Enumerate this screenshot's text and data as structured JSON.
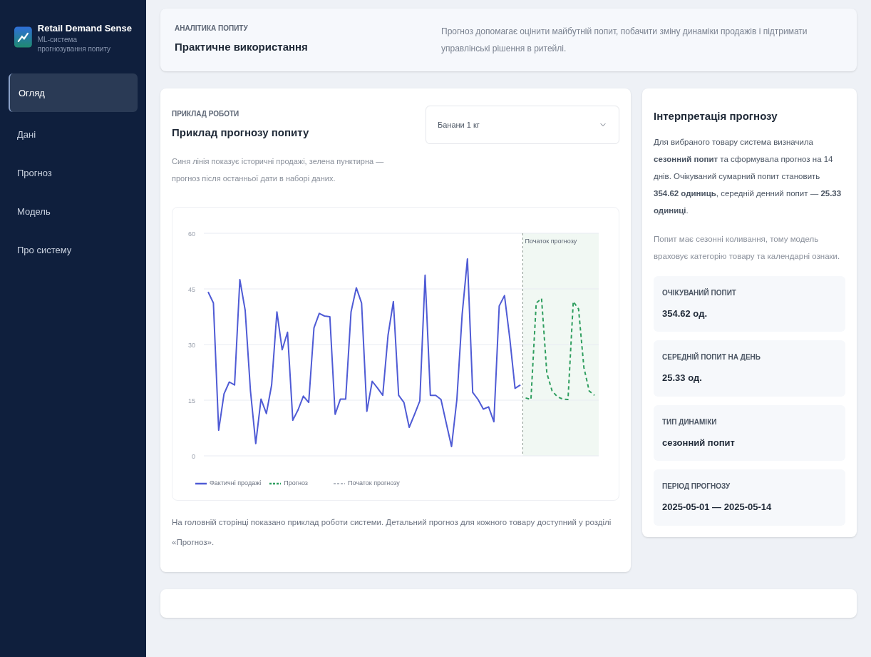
{
  "sidebar": {
    "brand": {
      "title": "Retail Demand Sense",
      "subtitle": "ML-система прогнозування попиту"
    },
    "items": [
      {
        "label": "Огляд",
        "selected": true
      },
      {
        "label": "Дані",
        "selected": false
      },
      {
        "label": "Прогноз",
        "selected": false
      },
      {
        "label": "Модель",
        "selected": false
      },
      {
        "label": "Про систему",
        "selected": false
      }
    ]
  },
  "header": {
    "eyebrow": "АНАЛІТИКА ПОПИТУ",
    "title": "Практичне використання",
    "description": "Прогноз допомагає оцінити майбутній попит, побачити зміну динаміки продажів і підтримати управлінські рішення в ритейлі."
  },
  "example": {
    "eyebrow": "ПРИКЛАД РОБОТИ",
    "title": "Приклад прогнозу попиту",
    "product_select": {
      "value": "Банани 1 кг"
    },
    "description": "Синя лінія показує історичні продажі, зелена пунктирна — прогноз після останньої дати в наборі даних.",
    "chart_data": {
      "type": "line",
      "ylim": [
        0,
        60
      ],
      "yticks": [
        0,
        15,
        30,
        45,
        60
      ],
      "grid": true,
      "legend": true,
      "series": [
        {
          "name": "Фактичні продажі",
          "color": "#4f5bd5",
          "line_style": "solid",
          "values": [
            44.2,
            41.2,
            6.9,
            16.7,
            19.9,
            19.1,
            47.5,
            39.2,
            17.5,
            3.3,
            15.3,
            11.4,
            19.1,
            38.8,
            28.6,
            33.3,
            9.6,
            12.4,
            16.1,
            14.4,
            34.5,
            38.4,
            37.7,
            37.5,
            11.2,
            15.3,
            15.3,
            38.8,
            45.3,
            41.2,
            12,
            20.1,
            18.3,
            16.3,
            32.5,
            41.6,
            16.3,
            14.4,
            7.7,
            11.2,
            14.8,
            48.7,
            16.3,
            16.3,
            15.2,
            8.8,
            2.5,
            15.2,
            38.1,
            53.1,
            17.1,
            15.2,
            12.6,
            13.2,
            9.2,
            40.4,
            43.2,
            31.7,
            18.2,
            19.1,
            null,
            null,
            null,
            null,
            null,
            null,
            null,
            null,
            null,
            null,
            null,
            null,
            null,
            null
          ]
        },
        {
          "name": "Прогноз",
          "color": "#2f9e5f",
          "line_style": "dashed",
          "values": [
            null,
            null,
            null,
            null,
            null,
            null,
            null,
            null,
            null,
            null,
            null,
            null,
            null,
            null,
            null,
            null,
            null,
            null,
            null,
            null,
            null,
            null,
            null,
            null,
            null,
            null,
            null,
            null,
            null,
            null,
            null,
            null,
            null,
            null,
            null,
            null,
            null,
            null,
            null,
            null,
            null,
            null,
            null,
            null,
            null,
            null,
            null,
            null,
            null,
            null,
            null,
            null,
            null,
            null,
            null,
            null,
            null,
            null,
            null,
            null,
            15.6,
            15.2,
            41.2,
            42.4,
            22.3,
            17.5,
            15.9,
            15.3,
            15.2,
            41.6,
            39.6,
            23.8,
            17.5,
            16.3
          ]
        }
      ]
    },
    "forecast_start_label": "Початок прогнозу",
    "legend_boundary": "Початок прогнозу",
    "footnote": "На головній сторінці показано приклад роботи системи. Детальний прогноз для кожного товару доступний у розділі «Прогноз»."
  },
  "interpretation": {
    "title": "Інтерпретація прогнозу",
    "summary": "Для вибраного товару система визначила **сезонний попит** та сформувала прогноз на 14 днів. Очікуваний сумарний попит становить **354.62 одиниць**, середній денний попит — **25.33 одиниці**.",
    "note": "Попит має сезонні коливання, тому модель враховує категорію товару та календарні ознаки.",
    "metrics": [
      {
        "label": "ОЧІКУВАНИЙ ПОПИТ",
        "value": "354.62 од."
      },
      {
        "label": "СЕРЕДНІЙ ПОПИТ НА ДЕНЬ",
        "value": "25.33 од."
      },
      {
        "label": "ТИП ДИНАМІКИ",
        "value": "сезонний попит"
      },
      {
        "label": "ПЕРІОД ПРОГНОЗУ",
        "value": "2025-05-01 — 2025-05-14"
      }
    ]
  }
}
